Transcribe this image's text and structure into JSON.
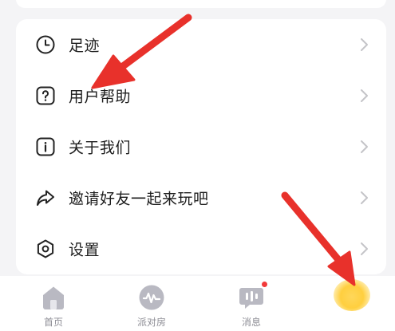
{
  "menu": {
    "items": [
      {
        "label": "足迹",
        "icon": "clock-icon"
      },
      {
        "label": "用户帮助",
        "icon": "help-question-icon"
      },
      {
        "label": "关于我们",
        "icon": "info-icon"
      },
      {
        "label": "邀请好友一起来玩吧",
        "icon": "share-arrow-icon"
      },
      {
        "label": "设置",
        "icon": "settings-hexagon-icon"
      }
    ]
  },
  "tabbar": {
    "tabs": [
      {
        "label": "首页",
        "icon": "home-icon"
      },
      {
        "label": "派对房",
        "icon": "party-wave-icon"
      },
      {
        "label": "消息",
        "icon": "message-icon",
        "has_dot": true
      }
    ]
  },
  "colors": {
    "arrow": "#e8312b",
    "tab_icon": "#b9b9c2",
    "notification_dot": "#f23a3a",
    "highlight": "#ffcf3f"
  }
}
